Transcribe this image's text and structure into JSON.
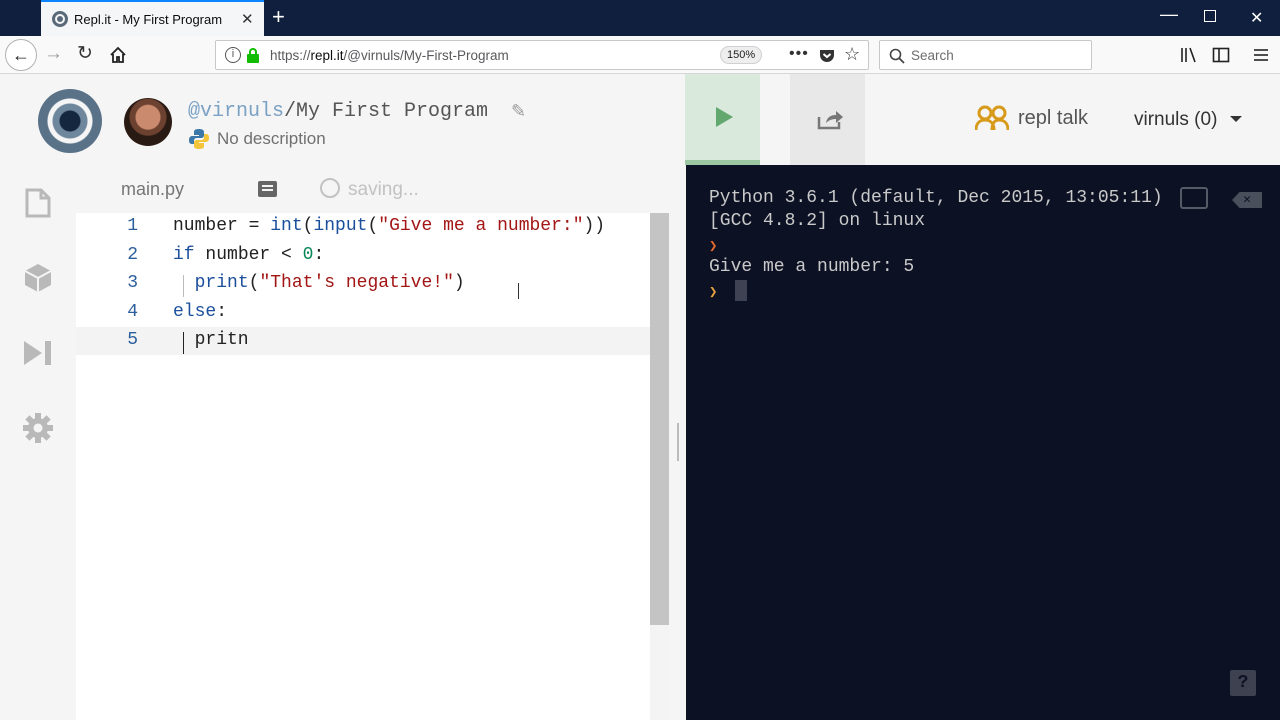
{
  "browser": {
    "tab_title": "Repl.it - My First Program",
    "url_prefix": "https://",
    "url_host": "repl.it",
    "url_path": "/@virnuls/My-First-Program",
    "zoom": "150%",
    "search_placeholder": "Search"
  },
  "header": {
    "owner": "@virnuls",
    "separator": "/",
    "repl_name": "My First Program",
    "description": "No description",
    "talk_label": "repl talk",
    "user_label": "virnuls (0)"
  },
  "editor": {
    "file_name": "main.py",
    "status": "saving...",
    "line_numbers": [
      "1",
      "2",
      "3",
      "4",
      "5"
    ]
  },
  "console": {
    "line1": "Python 3.6.1 (default, Dec 2015, 13:05:11)",
    "line2": "[GCC 4.8.2] on linux",
    "line3": "Give me a number: 5",
    "help": "?"
  },
  "colors": {
    "accent": "#62a86e",
    "console_bg": "#0d1124",
    "titlebar": "#0f1f3d"
  }
}
